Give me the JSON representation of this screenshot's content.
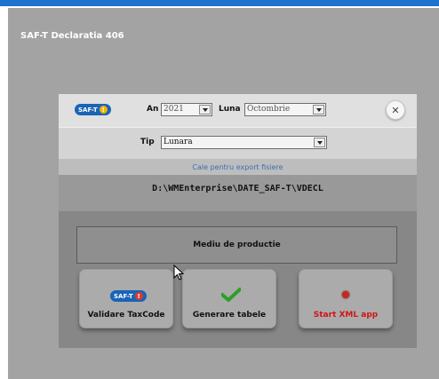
{
  "window": {
    "title": "SAF-T Declaratia 406"
  },
  "logo": {
    "text": "SAF-T",
    "mark": "!"
  },
  "period": {
    "year_label": "An",
    "year_value": "2021",
    "month_label": "Luna",
    "month_value": "Octombrie"
  },
  "type": {
    "label": "Tip",
    "value": "Lunara"
  },
  "export": {
    "label": "Cale pentru export fisiere",
    "path": "D:\\WMEnterprise\\DATE_SAF-T\\VDECL"
  },
  "environment": {
    "label": "Mediu de productie"
  },
  "buttons": {
    "validate": {
      "label": "Validare TaxCode",
      "badge_text": "SAF-T",
      "badge_mark": "!"
    },
    "generate": {
      "label": "Generare tabele"
    },
    "start_xml": {
      "label": "Start XML app"
    }
  },
  "colors": {
    "accent": "#1e73cf",
    "badge": "#1a64b7",
    "start_label": "#d21414",
    "check": "#2e9e27"
  }
}
